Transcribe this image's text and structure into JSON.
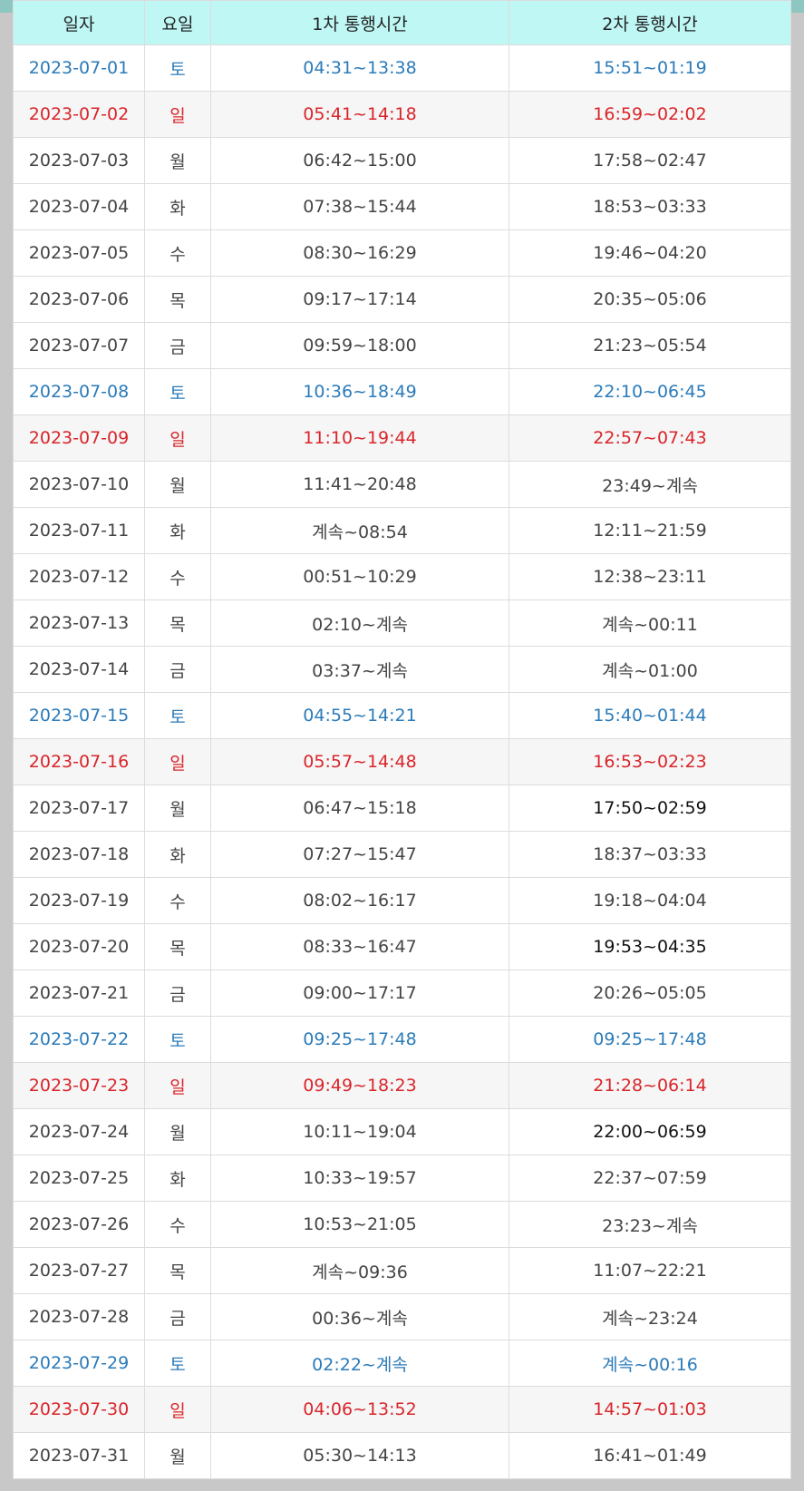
{
  "headers": [
    "일자",
    "요일",
    "1차 통행시간",
    "2차 통행시간"
  ],
  "colors": {
    "saturday": "#2b7bb9",
    "sunday": "#d9252a",
    "weekday": "#444444",
    "header_bg": "#bff7f5"
  },
  "rows": [
    {
      "date": "2023-07-01",
      "day": "토",
      "first": "04:31~13:38",
      "second": "15:51~01:19",
      "type": "sat"
    },
    {
      "date": "2023-07-02",
      "day": "일",
      "first": "05:41~14:18",
      "second": "16:59~02:02",
      "type": "sun"
    },
    {
      "date": "2023-07-03",
      "day": "월",
      "first": "06:42~15:00",
      "second": "17:58~02:47",
      "type": "wk"
    },
    {
      "date": "2023-07-04",
      "day": "화",
      "first": "07:38~15:44",
      "second": "18:53~03:33",
      "type": "wk"
    },
    {
      "date": "2023-07-05",
      "day": "수",
      "first": "08:30~16:29",
      "second": "19:46~04:20",
      "type": "wk"
    },
    {
      "date": "2023-07-06",
      "day": "목",
      "first": "09:17~17:14",
      "second": "20:35~05:06",
      "type": "wk"
    },
    {
      "date": "2023-07-07",
      "day": "금",
      "first": "09:59~18:00",
      "second": "21:23~05:54",
      "type": "wk"
    },
    {
      "date": "2023-07-08",
      "day": "토",
      "first": "10:36~18:49",
      "second": "22:10~06:45",
      "type": "sat"
    },
    {
      "date": "2023-07-09",
      "day": "일",
      "first": "11:10~19:44",
      "second": "22:57~07:43",
      "type": "sun"
    },
    {
      "date": "2023-07-10",
      "day": "월",
      "first": "11:41~20:48",
      "second": "23:49~계속",
      "type": "wk"
    },
    {
      "date": "2023-07-11",
      "day": "화",
      "first": "계속~08:54",
      "second": "12:11~21:59",
      "type": "wk"
    },
    {
      "date": "2023-07-12",
      "day": "수",
      "first": "00:51~10:29",
      "second": "12:38~23:11",
      "type": "wk"
    },
    {
      "date": "2023-07-13",
      "day": "목",
      "first": "02:10~계속",
      "second": "계속~00:11",
      "type": "wk"
    },
    {
      "date": "2023-07-14",
      "day": "금",
      "first": "03:37~계속",
      "second": "계속~01:00",
      "type": "wk"
    },
    {
      "date": "2023-07-15",
      "day": "토",
      "first": "04:55~14:21",
      "second": "15:40~01:44",
      "type": "sat"
    },
    {
      "date": "2023-07-16",
      "day": "일",
      "first": "05:57~14:48",
      "second": "16:53~02:23",
      "type": "sun"
    },
    {
      "date": "2023-07-17",
      "day": "월",
      "first": "06:47~15:18",
      "second": "17:50~02:59",
      "type": "wk",
      "dark2": true
    },
    {
      "date": "2023-07-18",
      "day": "화",
      "first": "07:27~15:47",
      "second": "18:37~03:33",
      "type": "wk"
    },
    {
      "date": "2023-07-19",
      "day": "수",
      "first": "08:02~16:17",
      "second": "19:18~04:04",
      "type": "wk"
    },
    {
      "date": "2023-07-20",
      "day": "목",
      "first": "08:33~16:47",
      "second": "19:53~04:35",
      "type": "wk",
      "dark2": true
    },
    {
      "date": "2023-07-21",
      "day": "금",
      "first": "09:00~17:17",
      "second": "20:26~05:05",
      "type": "wk"
    },
    {
      "date": "2023-07-22",
      "day": "토",
      "first": "09:25~17:48",
      "second": "09:25~17:48",
      "type": "sat"
    },
    {
      "date": "2023-07-23",
      "day": "일",
      "first": "09:49~18:23",
      "second": "21:28~06:14",
      "type": "sun"
    },
    {
      "date": "2023-07-24",
      "day": "월",
      "first": "10:11~19:04",
      "second": "22:00~06:59",
      "type": "wk",
      "dark2": true
    },
    {
      "date": "2023-07-25",
      "day": "화",
      "first": "10:33~19:57",
      "second": "22:37~07:59",
      "type": "wk"
    },
    {
      "date": "2023-07-26",
      "day": "수",
      "first": "10:53~21:05",
      "second": "23:23~계속",
      "type": "wk"
    },
    {
      "date": "2023-07-27",
      "day": "목",
      "first": "계속~09:36",
      "second": "11:07~22:21",
      "type": "wk"
    },
    {
      "date": "2023-07-28",
      "day": "금",
      "first": "00:36~계속",
      "second": "계속~23:24",
      "type": "wk"
    },
    {
      "date": "2023-07-29",
      "day": "토",
      "first": "02:22~계속",
      "second": "계속~00:16",
      "type": "sat"
    },
    {
      "date": "2023-07-30",
      "day": "일",
      "first": "04:06~13:52",
      "second": "14:57~01:03",
      "type": "sun"
    },
    {
      "date": "2023-07-31",
      "day": "월",
      "first": "05:30~14:13",
      "second": "16:41~01:49",
      "type": "wk"
    }
  ]
}
